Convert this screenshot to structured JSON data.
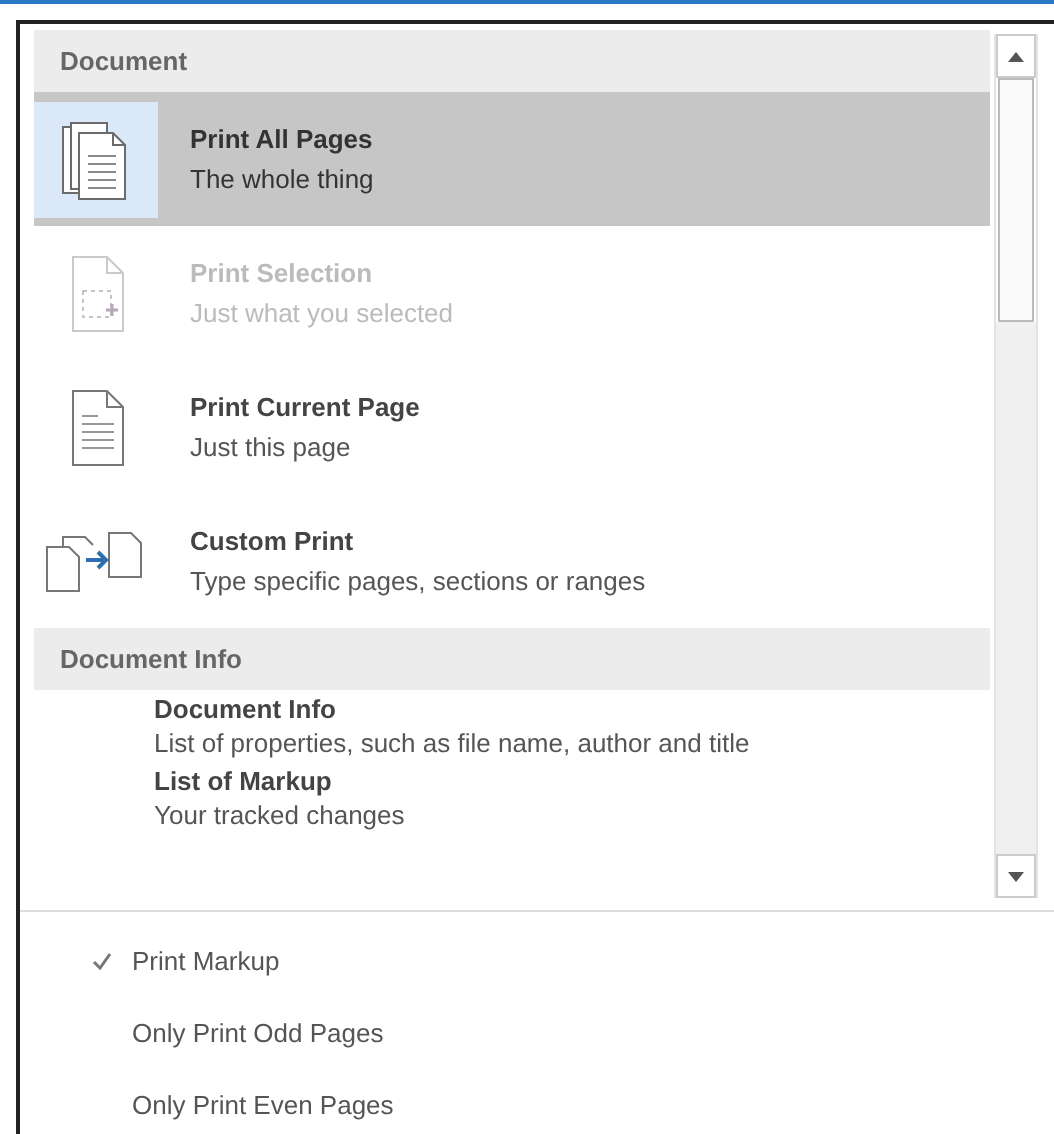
{
  "sections": [
    {
      "header": "Document",
      "items": [
        {
          "kind": "stack",
          "title": "Print All Pages",
          "subtitle": "The whole thing",
          "selected": true,
          "disabled": false
        },
        {
          "kind": "selection",
          "title": "Print Selection",
          "subtitle": "Just what you selected",
          "selected": false,
          "disabled": true
        },
        {
          "kind": "page",
          "title": "Print Current Page",
          "subtitle": "Just this page",
          "selected": false,
          "disabled": false
        },
        {
          "kind": "custom",
          "title": "Custom Print",
          "subtitle": "Type specific pages, sections or ranges",
          "selected": false,
          "disabled": false
        }
      ]
    },
    {
      "header": "Document Info",
      "items": [
        {
          "kind": "text",
          "title": "Document Info",
          "subtitle": "List of properties, such as file name, author and title",
          "selected": false,
          "disabled": false
        },
        {
          "kind": "text",
          "title": "List of Markup",
          "subtitle": "Your tracked changes",
          "selected": false,
          "disabled": false
        }
      ]
    }
  ],
  "options": [
    {
      "label": "Print Markup",
      "checked": true
    },
    {
      "label": "Only Print Odd Pages",
      "checked": false
    },
    {
      "label": "Only Print Even Pages",
      "checked": false
    }
  ]
}
